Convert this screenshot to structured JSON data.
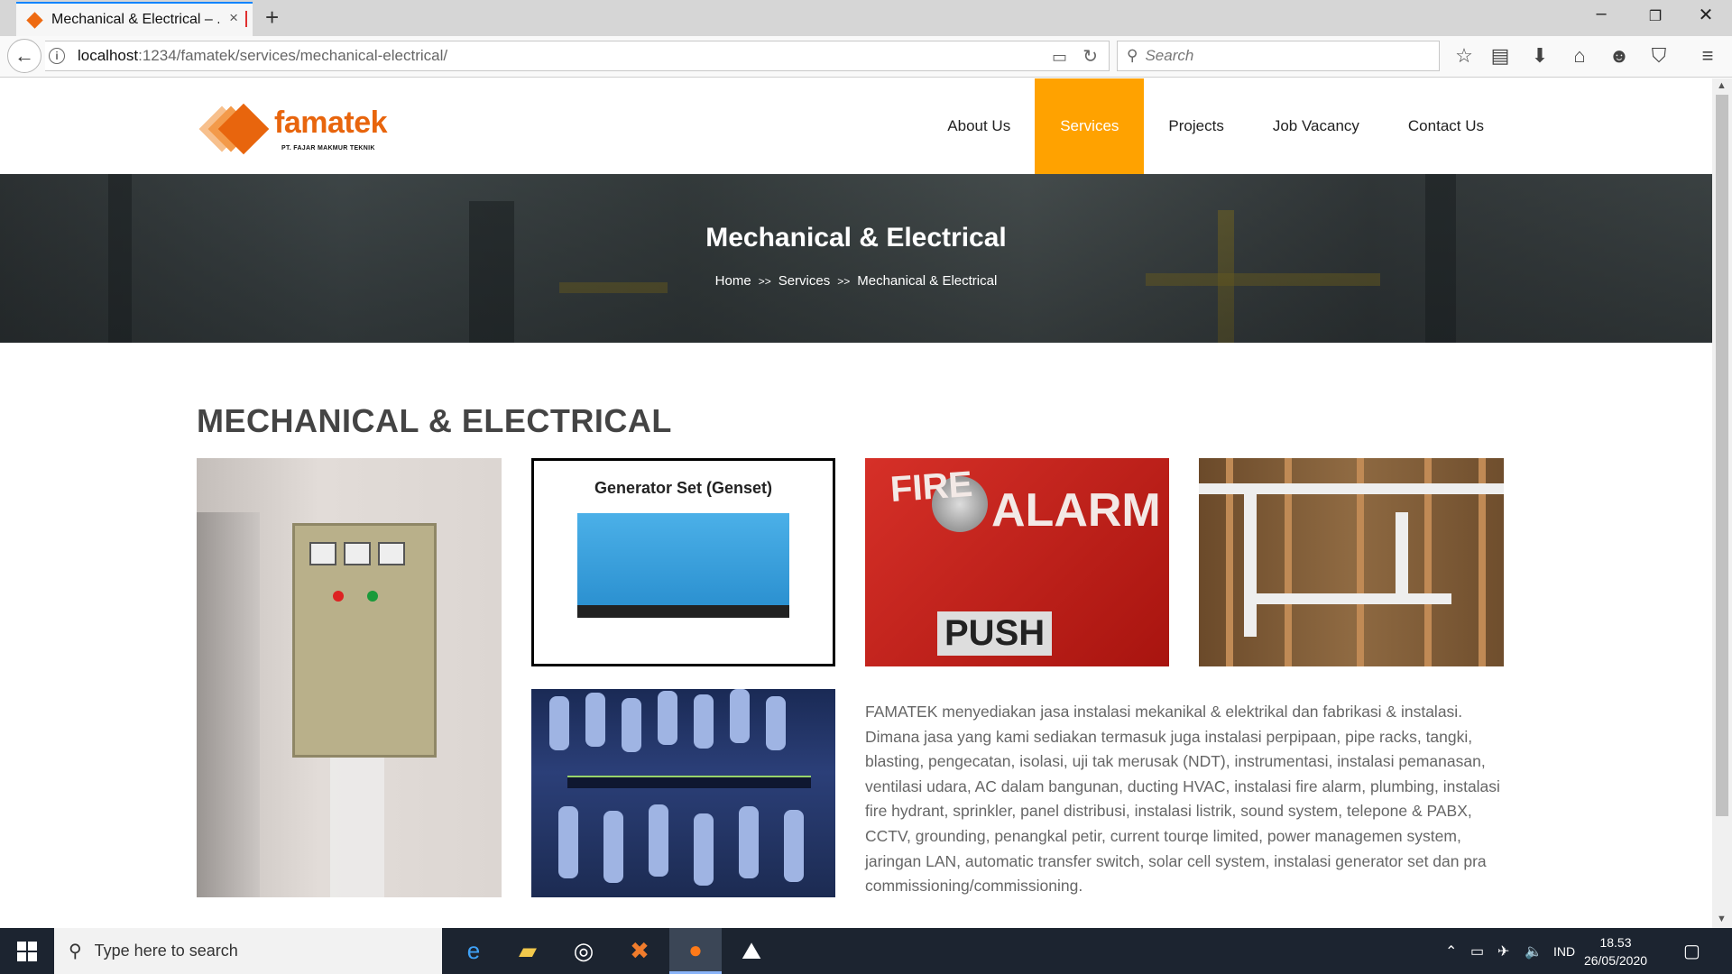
{
  "browser": {
    "tab_title": "Mechanical & Electrical – ...",
    "url_host": "localhost",
    "url_path": ":1234/famatek/services/mechanical-electrical/",
    "search_placeholder": "Search"
  },
  "site": {
    "logo_name": "famatek",
    "logo_subtitle": "PT. FAJAR MAKMUR TEKNIK",
    "menu": [
      {
        "label": "About Us"
      },
      {
        "label": "Services",
        "active": true
      },
      {
        "label": "Projects"
      },
      {
        "label": "Job Vacancy"
      },
      {
        "label": "Contact Us"
      }
    ],
    "accent_color": "#ffa200",
    "brand_color": "#e8650d"
  },
  "banner": {
    "title": "Mechanical & Electrical",
    "breadcrumb": [
      "Home",
      "Services",
      "Mechanical & Electrical"
    ],
    "separator": ">>"
  },
  "content": {
    "heading": "MECHANICAL & ELECTRICAL",
    "genset_caption": "Generator Set (Genset)",
    "alarm_text_fire": "FIRE",
    "alarm_text_alarm": "ALARM",
    "alarm_text_push": "PUSH",
    "description": "FAMATEK menyediakan jasa instalasi mekanikal & elektrikal dan fabrikasi & instalasi. Dimana jasa yang kami sediakan termasuk juga instalasi perpipaan, pipe racks, tangki, blasting, pengecatan, isolasi, uji tak merusak (NDT), instrumentasi, instalasi pemanasan, ventilasi udara,  AC dalam bangunan, ducting HVAC, instalasi fire alarm, plumbing, instalasi fire hydrant, sprinkler, panel distribusi, instalasi listrik, sound system, telepone & PABX, CCTV, grounding, penangkal petir, current tourqe limited, power managemen system, jaringan LAN, automatic transfer switch, solar cell system, instalasi generator set dan pra commissioning/commissioning."
  },
  "taskbar": {
    "search_placeholder": "Type here to search",
    "language": "IND",
    "time": "18.53",
    "date": "26/05/2020"
  }
}
